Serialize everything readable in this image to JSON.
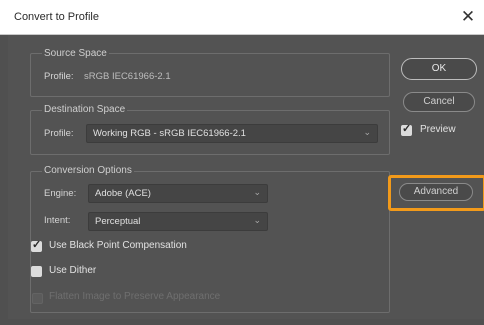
{
  "window": {
    "title": "Convert to Profile",
    "close_glyph": "✕"
  },
  "source_space": {
    "legend": "Source Space",
    "profile_label": "Profile:",
    "profile_value": "sRGB IEC61966-2.1"
  },
  "destination_space": {
    "legend": "Destination Space",
    "profile_label": "Profile:",
    "profile_value": "Working RGB - sRGB IEC61966-2.1"
  },
  "conversion_options": {
    "legend": "Conversion Options",
    "engine_label": "Engine:",
    "engine_value": "Adobe (ACE)",
    "intent_label": "Intent:",
    "intent_value": "Perceptual",
    "black_point_label": "Use Black Point Compensation",
    "dither_label": "Use Dither",
    "flatten_label": "Flatten Image to Preserve Appearance"
  },
  "buttons": {
    "ok": "OK",
    "cancel": "Cancel",
    "preview_label": "Preview",
    "advanced": "Advanced"
  },
  "colors": {
    "accent_highlight": "#f29a1a",
    "dialog_bg": "#535353"
  }
}
